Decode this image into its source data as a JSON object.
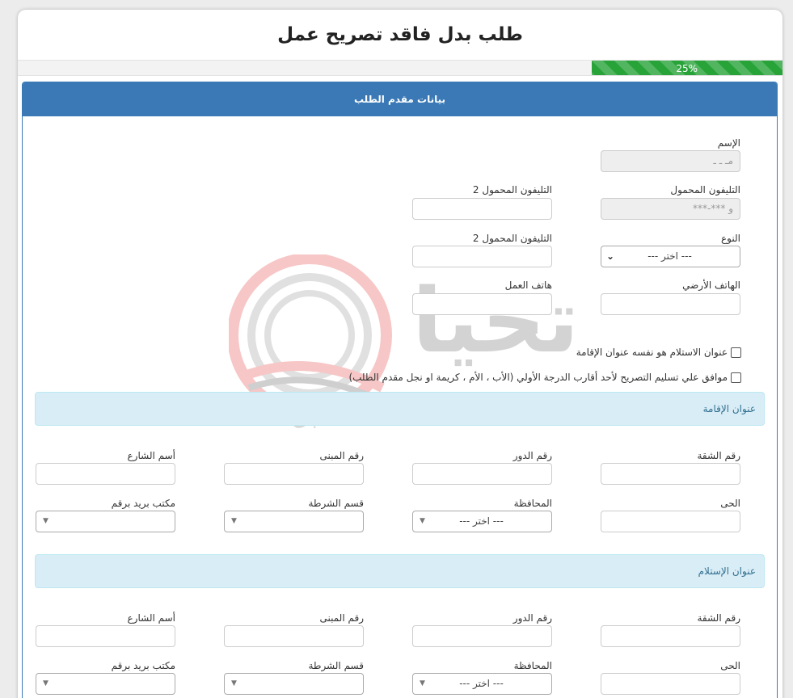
{
  "title": "طلب بدل فاقد تصريح عمل",
  "progress": {
    "label": "25%",
    "value": 0.25
  },
  "panel_title": "بيانات مقدم الطلب",
  "applicant": {
    "name_label": "الإسم",
    "name_value": "مـ ـ ـ",
    "mobile_label": "التليفون المحمول",
    "mobile_value": "و ***-***",
    "mobile2_label_a": "التليفون المحمول 2",
    "mobile2_label_b": "التليفون المحمول 2",
    "gender_label": "النوع",
    "gender_value": "--- اختر ---",
    "landline_label": "الهاتف الأرضي",
    "work_phone_label": "هاتف العمل"
  },
  "checkboxes": {
    "same_address": "عنوان الاستلام هو نفسه عنوان الإقامة",
    "agree_relative": "موافق علي تسليم التصريح لأحد أقارب الدرجة الأولي (الأب ، الأم ، كريمة او نجل مقدم الطلب)"
  },
  "residence": {
    "section_title": "عنوان الإقامة",
    "apartment_label": "رقم الشقة",
    "floor_label": "رقم الدور",
    "building_label": "رقم المبنى",
    "street_label": "أسم الشارع",
    "district_label": "الحى",
    "governorate_label": "المحافظة",
    "governorate_value": "--- اختر ---",
    "police_label": "قسم الشرطة",
    "post_label": "مكتب بريد برقم"
  },
  "delivery": {
    "section_title": "عنوان الإستلام",
    "apartment_label": "رقم الشقة",
    "floor_label": "رقم الدور",
    "building_label": "رقم المبنى",
    "street_label": "أسم الشارع",
    "district_label": "الحى",
    "governorate_label": "المحافظة",
    "governorate_value": "--- اختر ---",
    "police_label": "قسم الشرطة",
    "post_label": "مكتب بريد برقم"
  },
  "watermark": {
    "text_main": "تحيا مصر",
    "text_sub": "المستقبل"
  },
  "colors": {
    "primary": "#3a79b6",
    "progress": "#27a338",
    "info_bg": "#d9edf7",
    "info_text": "#31708f"
  }
}
